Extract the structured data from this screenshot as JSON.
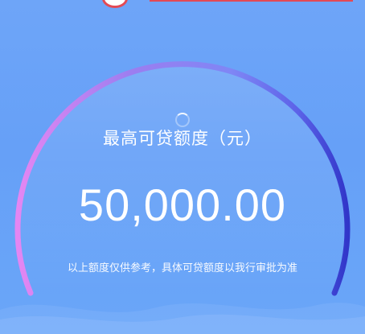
{
  "gauge": {
    "label": "最高可贷额度（元）",
    "amount": "50,000.00",
    "note": "以上额度仅供参考，具体可贷额度以我行审批为准"
  },
  "colors": {
    "background": "#6aa3f8",
    "arc_gradient_start": "#e07cf0",
    "arc_gradient_end": "#3a3fd8",
    "top_accent": "#e34a55"
  },
  "icons": {
    "spinner": "loading-spinner-icon"
  }
}
